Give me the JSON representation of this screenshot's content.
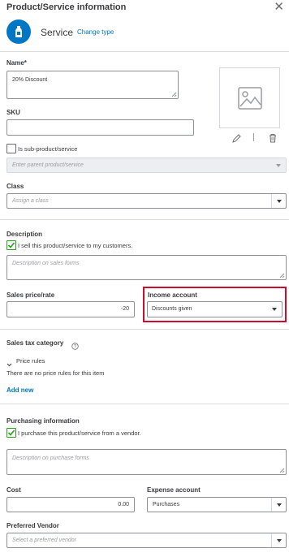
{
  "header": {
    "title": "Product/Service information"
  },
  "type": {
    "label": "Service",
    "change_link": "Change type"
  },
  "name": {
    "label": "Name*",
    "value": "20% Discount"
  },
  "sku": {
    "label": "SKU",
    "value": ""
  },
  "sub_product": {
    "label": "Is sub-product/service",
    "checked": false,
    "parent_placeholder": "Enter parent product/service"
  },
  "class_field": {
    "label": "Class",
    "placeholder": "Assign a class"
  },
  "description": {
    "label": "Description",
    "sell_checkbox": "I sell this product/service to my customers.",
    "sell_checked": true,
    "placeholder": "Description on sales forms"
  },
  "sales_price": {
    "label": "Sales price/rate",
    "value": "-20"
  },
  "income_account": {
    "label": "Income account",
    "value": "Discounts given",
    "highlight_color": "#c8102e"
  },
  "sales_tax": {
    "label": "Sales tax category"
  },
  "price_rules": {
    "label": "Price rules",
    "empty_text": "There are no price rules for this item"
  },
  "add_new": {
    "label": "Add new"
  },
  "purchasing": {
    "label": "Purchasing information",
    "purchase_checkbox": "I purchase this product/service from a vendor.",
    "purchase_checked": true,
    "placeholder": "Description on purchase forms"
  },
  "cost": {
    "label": "Cost",
    "value": "0.00"
  },
  "expense_account": {
    "label": "Expense account",
    "value": "Purchases"
  },
  "preferred_vendor": {
    "label": "Preferred Vendor",
    "placeholder": "Select a preferred vendor"
  },
  "colors": {
    "accent": "#0077c5",
    "check": "#2ca01c",
    "highlight": "#c8102e"
  }
}
